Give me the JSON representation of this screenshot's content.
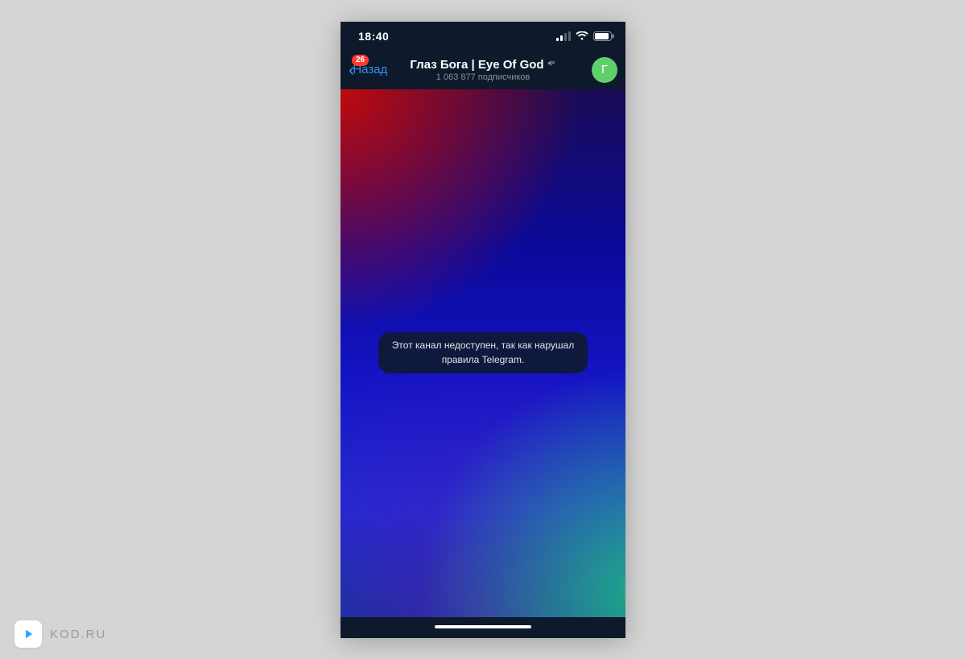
{
  "status": {
    "time": "18:40"
  },
  "header": {
    "back_label": "Назад",
    "unread_badge": "26",
    "title": "Глаз Бога | Eye Of God",
    "subscribers": "1 063 877 подписчиков",
    "avatar_letter": "Г",
    "mute_icon": "muted-icon"
  },
  "message": {
    "text": "Этот канал недоступен, так как нарушал правила Telegram."
  },
  "watermark": {
    "text": "KOD.RU"
  },
  "colors": {
    "phone_chrome": "#0e1a2b",
    "accent": "#3390ec",
    "badge": "#ff3b30",
    "avatar": "#5fcf6c"
  }
}
